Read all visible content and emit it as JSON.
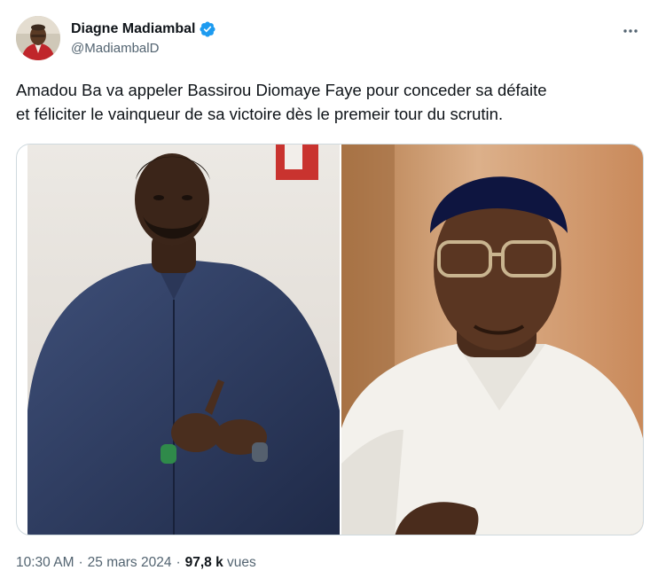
{
  "author": {
    "display_name": "Diagne Madiambal",
    "handle": "@MadiambalD",
    "verified": true,
    "avatar_icon": "avatar"
  },
  "icons": {
    "verified": "verified-badge-icon",
    "more": "more-options-icon"
  },
  "tweet": {
    "text": "Amadou Ba va appeler Bassirou Diomaye Faye pour conceder sa défaite\net féliciter le vainqueur de sa victoire dès le premeir tour du scrutin."
  },
  "media": {
    "left_photo": "photo-man-in-blue-tunic",
    "right_photo": "photo-man-in-blue-cap-white-robe"
  },
  "meta": {
    "time": "10:30 AM",
    "separator": "·",
    "date": "25 mars 2024",
    "views_count": "97,8 k",
    "views_label": "vues"
  },
  "colors": {
    "verified_blue": "#1d9bf0",
    "secondary_text": "#536471",
    "primary_text": "#0f1419",
    "border": "#cfd9de"
  }
}
